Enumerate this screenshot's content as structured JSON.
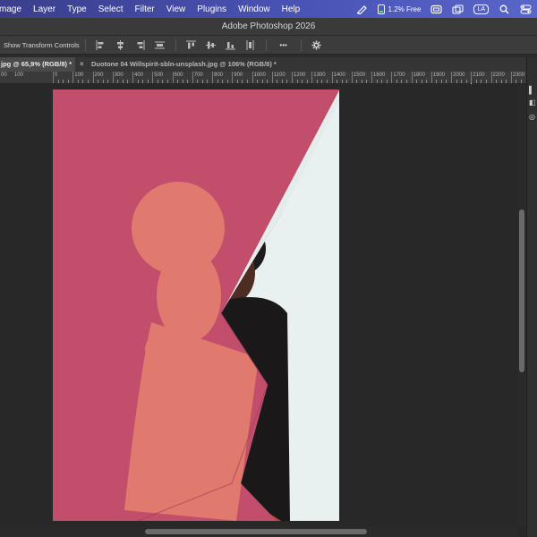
{
  "menubar": {
    "items": [
      "mage",
      "Layer",
      "Type",
      "Select",
      "Filter",
      "View",
      "Plugins",
      "Window",
      "Help"
    ],
    "battery_text": "1.2% Free",
    "input_badge": "LA"
  },
  "titlebar": {
    "title": "Adobe Photoshop 2026"
  },
  "options": {
    "transform_label": "Show Transform Controls",
    "more_label": "•••"
  },
  "tabs": [
    {
      "label": "jpg @ 65,9% (RGB/8) *"
    },
    {
      "label": "Duotone 04 Willspirit-sbln-unsplash.jpg @ 106% (RGB/8) *",
      "close": "×"
    }
  ],
  "ruler": {
    "labels": [
      "0",
      "100",
      "200",
      "300",
      "400",
      "500",
      "600",
      "700",
      "800",
      "900",
      "1000",
      "1100",
      "1200",
      "1300",
      "1400",
      "1500",
      "1600",
      "1700",
      "1800",
      "1900",
      "2000",
      "2100",
      "2200",
      "2300"
    ],
    "leading_labels": [
      "00",
      "100"
    ]
  },
  "colors": {
    "duotone_pink": "#c94e6b",
    "salmon_overlay": "#e8786a",
    "wall": "#e8f0ef",
    "workspace": "#282828"
  },
  "icons": {
    "notch": "notch-icon",
    "battery": "battery-icon",
    "share": "cast-icon",
    "settings": "gear-icon"
  }
}
